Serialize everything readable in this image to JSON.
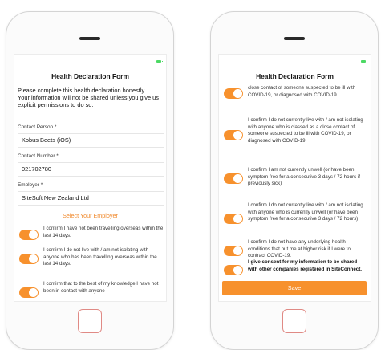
{
  "left_screen": {
    "title": "Health Declaration Form",
    "intro": "Please complete this health declaration honestly.\nYour information will not be shared unless you give us explicit permissions to do so.",
    "contact_person_label": "Contact Person *",
    "contact_person_value": "Kobus Beets (iOS)",
    "contact_number_label": "Contact Number *",
    "contact_number_value": "021702780",
    "employer_label": "Employer *",
    "employer_value": "SiteSoft New Zealand Ltd",
    "select_employer_link": "Select Your Employer",
    "consents": [
      {
        "text": "I confirm I have not been travelling overseas within the last 14 days.",
        "checked": true
      },
      {
        "text": "I confirm I do not live with / am not isolating with anyone who has been travelling overseas within the last 14 days.",
        "checked": true
      },
      {
        "text": "I confirm that to the best of my knowledge I have not been in contact with anyone",
        "checked": true
      }
    ]
  },
  "right_screen": {
    "title": "Health Declaration Form",
    "consents": [
      {
        "text": "close contact of someone suspected to be ill with COVID-19, or diagnosed with COVID-19.",
        "checked": true
      },
      {
        "text": "I confirm I do not currently live with / am not isolating with anyone who is classed as a close contact of someone suspected to be ill with COVID-19, or diagnosed with COVID-19.",
        "checked": true
      },
      {
        "text": "I confirm I am not currently unwell (or have been symptom free for a consecutive 3 days / 72 hours if previously sick)",
        "checked": true
      },
      {
        "text": "I confirm I do not currently live with / am not isolating with anyone who is currently unwell (or have been symptom free for a consecutive 3 days / 72 hours)",
        "checked": true
      },
      {
        "text": "I confirm I do not have any underlying health conditions that put me at higher risk if I were to contract COVID-19.",
        "checked": true
      },
      {
        "text": "I give consent for my information to be shared with other companies registered in SiteConnect.",
        "checked": true
      }
    ],
    "save_label": "Save"
  },
  "colors": {
    "accent": "#f7912d",
    "link": "#f0882a",
    "home_button": "#e08a85",
    "battery": "#4cd964"
  },
  "icons": [
    "battery-icon",
    "toggle-switch-on",
    "home-button"
  ]
}
